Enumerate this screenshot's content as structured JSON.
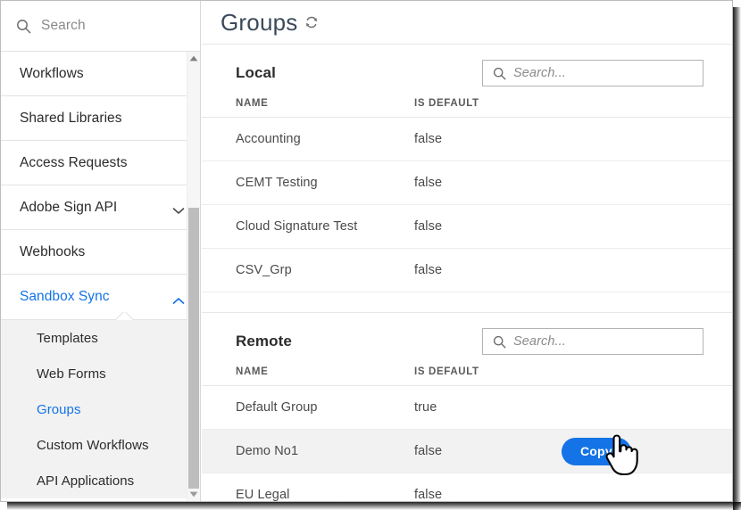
{
  "sidebar": {
    "search": {
      "placeholder": "Search",
      "icon": "search-icon",
      "value": ""
    },
    "items": [
      {
        "label": "Workflows",
        "expandable": false
      },
      {
        "label": "Shared Libraries",
        "expandable": false
      },
      {
        "label": "Access Requests",
        "expandable": false
      },
      {
        "label": "Adobe Sign API",
        "expandable": true,
        "expanded": false,
        "icon": "chevron-down-icon"
      },
      {
        "label": "Webhooks",
        "expandable": false
      },
      {
        "label": "Sandbox Sync",
        "expandable": true,
        "expanded": true,
        "active": true,
        "icon": "chevron-up-icon"
      }
    ],
    "subitems": [
      {
        "label": "Templates",
        "selected": false
      },
      {
        "label": "Web Forms",
        "selected": false
      },
      {
        "label": "Groups",
        "selected": true
      },
      {
        "label": "Custom Workflows",
        "selected": false
      },
      {
        "label": "API Applications",
        "selected": false
      }
    ],
    "scrollbar": {
      "up_icon": "scroll-up-arrow-icon",
      "down_icon": "scroll-down-arrow-icon"
    }
  },
  "header": {
    "title": "Groups",
    "refresh_icon": "refresh-icon"
  },
  "sections": [
    {
      "id": "local",
      "title": "Local",
      "search": {
        "placeholder": "Search...",
        "icon": "search-icon",
        "value": ""
      },
      "columns": [
        "NAME",
        "IS DEFAULT"
      ],
      "rows": [
        {
          "name": "Accounting",
          "is_default": "false",
          "action": "",
          "hover": false
        },
        {
          "name": "CEMT Testing",
          "is_default": "false",
          "action": "",
          "hover": false
        },
        {
          "name": "Cloud Signature Test",
          "is_default": "false",
          "action": "",
          "hover": false
        },
        {
          "name": "CSV_Grp",
          "is_default": "false",
          "action": "",
          "hover": false
        }
      ]
    },
    {
      "id": "remote",
      "title": "Remote",
      "search": {
        "placeholder": "Search...",
        "icon": "search-icon",
        "value": ""
      },
      "columns": [
        "NAME",
        "IS DEFAULT"
      ],
      "rows": [
        {
          "name": "Default Group",
          "is_default": "true",
          "action": "",
          "hover": false
        },
        {
          "name": "Demo No1",
          "is_default": "false",
          "action": "Copy",
          "hover": true
        },
        {
          "name": "EU Legal",
          "is_default": "false",
          "action": "",
          "hover": false
        }
      ]
    }
  ],
  "colors": {
    "accent_blue": "#1473e6",
    "title_gray": "#3b4a5a",
    "row_hover": "#f2f2f2",
    "submenu_bg": "#f2f2f2",
    "border": "#e6e6e6"
  },
  "cursor": {
    "type": "pointing-hand"
  }
}
